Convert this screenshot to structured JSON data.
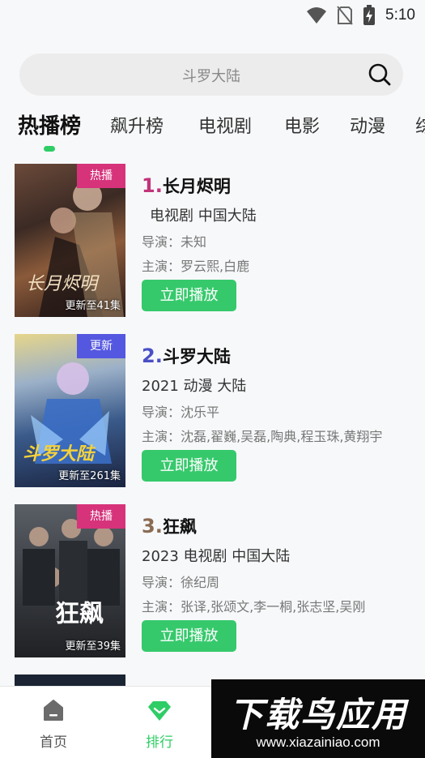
{
  "status_bar": {
    "time": "5:10"
  },
  "search": {
    "placeholder": "斗罗大陆"
  },
  "tabs": [
    {
      "label": "热播榜",
      "active": true
    },
    {
      "label": "飙升榜"
    },
    {
      "label": "电视剧"
    },
    {
      "label": "电影"
    },
    {
      "label": "动漫"
    },
    {
      "label": "综"
    }
  ],
  "items": [
    {
      "rank": "1.",
      "rank_color": "#c2337a",
      "title": "长月烬明",
      "meta": "电视剧  中国大陆",
      "director": "导演：未知",
      "cast": "主演：罗云熙,白鹿",
      "badge": "热播",
      "badge_color": "#d6337b",
      "update": "更新至41集",
      "poster_text": "长月烬明",
      "play": "立即播放"
    },
    {
      "rank": "2.",
      "rank_color": "#4a4fc7",
      "title": "斗罗大陆",
      "meta": "2021  动漫  大陆",
      "director": "导演：沈乐平",
      "cast": "主演：沈磊,翟巍,吴磊,陶典,程玉珠,黄翔宇",
      "badge": "更新",
      "badge_color": "#5457e0",
      "update": "更新至261集",
      "poster_text": "斗罗大陆",
      "play": "立即播放"
    },
    {
      "rank": "3.",
      "rank_color": "#8a6a52",
      "title": "狂飙",
      "meta": "2023  电视剧  中国大陆",
      "director": "导演：徐纪周",
      "cast": "主演：张译,张颂文,李一桐,张志坚,吴刚",
      "badge": "热播",
      "badge_color": "#d6337b",
      "update": "更新至39集",
      "poster_text": "狂飙",
      "play": "立即播放"
    }
  ],
  "bottom_nav": [
    {
      "label": "首页",
      "icon": "home-icon"
    },
    {
      "label": "排行",
      "icon": "ranking-diamond-icon",
      "active": true
    }
  ],
  "watermark": {
    "big": "下载鸟应用",
    "small": "www.xiazainiao.com"
  },
  "colors": {
    "accent": "#36c96c",
    "tab_indicator": "#2fcd66"
  }
}
